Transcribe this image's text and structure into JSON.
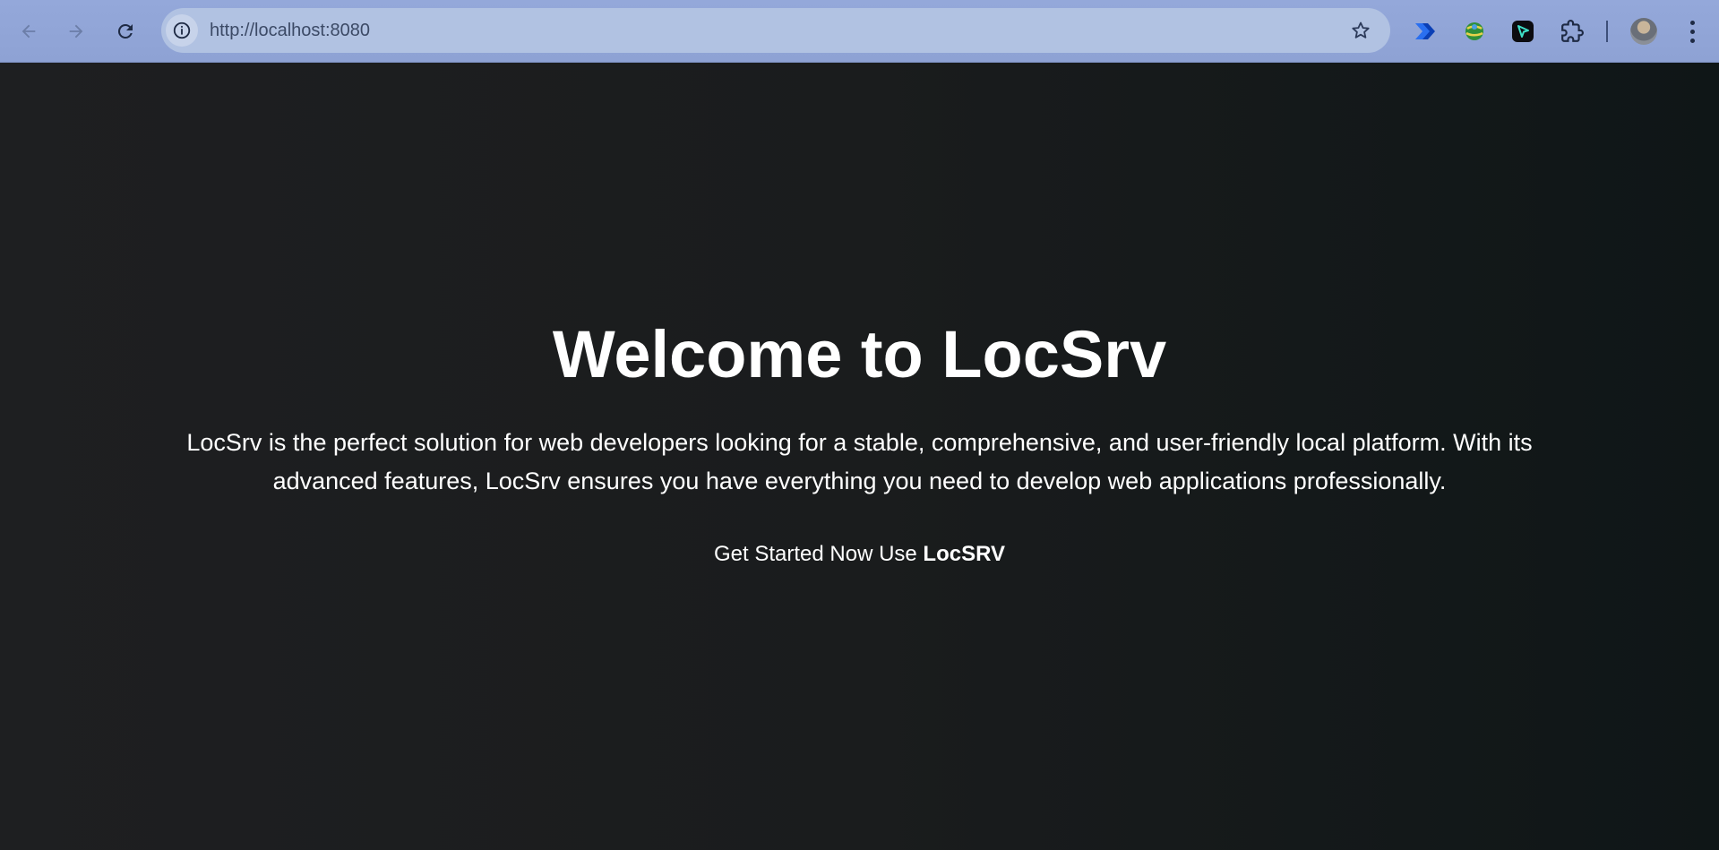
{
  "browser": {
    "url": "http://localhost:8080",
    "icons": [
      "back-arrow-icon",
      "forward-arrow-icon",
      "reload-icon",
      "site-info-icon",
      "bookmark-star-icon",
      "power-automate-icon",
      "globe-extension-icon",
      "cursor-extension-icon",
      "extensions-puzzle-icon",
      "profile-avatar",
      "menu-dots-icon"
    ]
  },
  "page": {
    "title": "Welcome to LocSrv",
    "description": "LocSrv is the perfect solution for web developers looking for a stable, comprehensive, and user-friendly local platform. With its advanced features, LocSrv ensures you have everything you need to develop web applications professionally.",
    "cta_prefix": "Get Started Now Use ",
    "cta_brand": "LocSRV"
  },
  "colors": {
    "toolbar": "#8fa3d6",
    "omnibox": "#b1c2e2",
    "page_bg": "#1a1c1d",
    "text": "#ffffff"
  }
}
